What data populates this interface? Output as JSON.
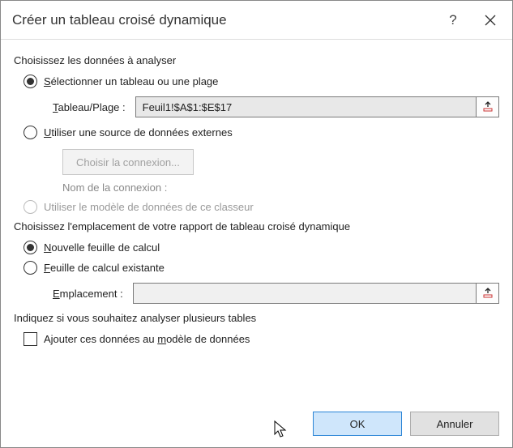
{
  "dialog": {
    "title": "Créer un tableau croisé dynamique",
    "help": "?"
  },
  "section1": {
    "title": "Choisissez les données à analyser",
    "opt_select_prefix": "S",
    "opt_select_rest": "électionner un tableau ou une plage",
    "range_label_prefix": "T",
    "range_label_rest": "ableau/Plage :",
    "range_value": "Feuil1!$A$1:$E$17",
    "opt_external_prefix": "U",
    "opt_external_rest": "tiliser une source de données externes",
    "choose_conn": "Choisir la connexion...",
    "conn_name_label": "Nom de la connexion :",
    "opt_model": "Utiliser le modèle de données de ce classeur"
  },
  "section2": {
    "title": "Choisissez l'emplacement de votre rapport de tableau croisé dynamique",
    "opt_new_prefix": "N",
    "opt_new_rest": "ouvelle feuille de calcul",
    "opt_exist_prefix": "F",
    "opt_exist_rest": "euille de calcul existante",
    "loc_label_prefix": "E",
    "loc_label_rest": "mplacement :"
  },
  "section3": {
    "title": "Indiquez si vous souhaitez analyser plusieurs tables",
    "chk_prefix": "Ajouter ces données au ",
    "chk_u": "m",
    "chk_rest": "odèle de données"
  },
  "footer": {
    "ok": "OK",
    "cancel": "Annuler"
  }
}
